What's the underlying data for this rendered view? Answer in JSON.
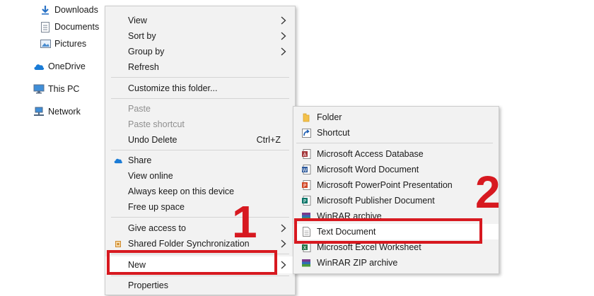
{
  "nav": {
    "items": [
      {
        "label": "Downloads",
        "icon": "download-arrow-icon"
      },
      {
        "label": "Documents",
        "icon": "document-icon"
      },
      {
        "label": "Pictures",
        "icon": "pictures-icon"
      },
      {
        "label": "OneDrive",
        "icon": "cloud-icon"
      },
      {
        "label": "This PC",
        "icon": "computer-icon"
      },
      {
        "label": "Network",
        "icon": "network-icon"
      }
    ]
  },
  "context_menu": {
    "items": [
      {
        "label": "View"
      },
      {
        "label": "Sort by"
      },
      {
        "label": "Group by"
      },
      {
        "label": "Refresh"
      },
      {
        "label": "Customize this folder..."
      },
      {
        "label": "Paste"
      },
      {
        "label": "Paste shortcut"
      },
      {
        "label": "Undo Delete",
        "shortcut": "Ctrl+Z"
      },
      {
        "label": "Share",
        "icon": "onedrive-cloud-icon"
      },
      {
        "label": "View online"
      },
      {
        "label": "Always keep on this device"
      },
      {
        "label": "Free up space"
      },
      {
        "label": "Give access to"
      },
      {
        "label": "Shared Folder Synchronization"
      },
      {
        "label": "New"
      },
      {
        "label": "Properties"
      }
    ]
  },
  "new_submenu": {
    "items": [
      {
        "label": "Folder",
        "icon": "folder-icon"
      },
      {
        "label": "Shortcut",
        "icon": "shortcut-icon"
      },
      {
        "label": "Microsoft Access Database",
        "icon": "access-icon"
      },
      {
        "label": "Microsoft Word Document",
        "icon": "word-icon"
      },
      {
        "label": "Microsoft PowerPoint Presentation",
        "icon": "powerpoint-icon"
      },
      {
        "label": "Microsoft Publisher Document",
        "icon": "publisher-icon"
      },
      {
        "label": "WinRAR archive",
        "icon": "winrar-icon"
      },
      {
        "label": "Text Document",
        "icon": "text-document-icon"
      },
      {
        "label": "Microsoft Excel Worksheet",
        "icon": "excel-icon"
      },
      {
        "label": "WinRAR ZIP archive",
        "icon": "winrar-zip-icon"
      }
    ]
  },
  "annotations": {
    "step1": "1",
    "step2": "2",
    "color": "#d71920"
  }
}
